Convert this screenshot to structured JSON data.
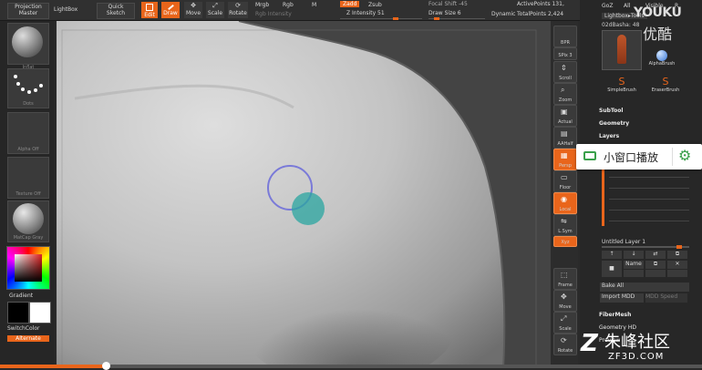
{
  "top_toolbar": {
    "projection_master": [
      "Projection",
      "Master"
    ],
    "lightbox": "LightBox",
    "quick_sketch": [
      "Quick",
      "Sketch"
    ],
    "edit": "Edit",
    "draw": "Draw",
    "move": "Move",
    "scale": "Scale",
    "rotate": "Rotate",
    "mrgb": "Mrgb",
    "rgb": "Rgb",
    "m": "M",
    "zadd": "Zadd",
    "zsub": "Zsub",
    "rgb_intensity": "Rgb Intensity",
    "z_intensity": "Z Intensity 51",
    "focal_shift": "Focal Shift -45",
    "draw_size": "Draw Size 6",
    "dynamic": "Dynamic",
    "active_points": "ActivePoints 131,",
    "total_points": "TotalPoints 2,424"
  },
  "left_panel": {
    "brush_label": "Inflat",
    "stroke_label": "Dots",
    "alpha_label": "Alpha Off",
    "texture_label": "Texture Off",
    "material_label": "MatCap Gray",
    "gradient_label": "Gradient",
    "switch_color_label": "SwitchColor",
    "alternate_label": "Alternate"
  },
  "view_controls": [
    {
      "name": "bpr",
      "label": "BPR"
    },
    {
      "name": "spix",
      "label": "SPix 3"
    },
    {
      "name": "scroll",
      "label": "Scroll"
    },
    {
      "name": "zoom",
      "label": "Zoom"
    },
    {
      "name": "actual",
      "label": "Actual"
    },
    {
      "name": "aahalf",
      "label": "AAHalf"
    },
    {
      "name": "persp",
      "label": "Persp"
    },
    {
      "name": "floor",
      "label": "Floor"
    },
    {
      "name": "local",
      "label": "Local"
    },
    {
      "name": "lsym",
      "label": "L.Sym"
    },
    {
      "name": "xyz",
      "label": "Xyz"
    },
    {
      "name": "frame",
      "label": "Frame"
    },
    {
      "name": "move",
      "label": "Move"
    },
    {
      "name": "scale",
      "label": "Scale"
    },
    {
      "name": "rotate",
      "label": "Rotate"
    }
  ],
  "right_panel": {
    "goz": "GoZ",
    "all": "All",
    "visible": "Visible",
    "r": "R",
    "lightbox_tools": "Lightbox▸Tools",
    "tool_name": "02dBasha: 48",
    "brushes": [
      {
        "name": "AlphaBrush"
      },
      {
        "name": "SimpleBrush"
      },
      {
        "name": "EraserBrush"
      }
    ],
    "subtool": "SubTool",
    "geometry": "Geometry",
    "layers": "Layers",
    "layer_name": "Untitled Layer 1",
    "name_btn": "Name",
    "bake_all": "Bake All",
    "import_mdd": "Import MDD",
    "mdd_speed": "MDD Speed",
    "fibermesh": "FiberMesh",
    "geometry_hd": "Geometry HD",
    "preview": "Preview"
  },
  "overlay": {
    "popup_label": "小窗口播放",
    "watermark_youku": "YOUKU",
    "watermark_youku_cn": "优酷",
    "watermark_site": "朱峰社区",
    "watermark_url": "ZF3D.COM"
  },
  "video_progress": 0.15,
  "colors": {
    "accent": "#e9651b",
    "popup_green": "#3aa04a",
    "cursor_ring": "#7a7ad8",
    "cursor_fill": "#2aa6a0"
  }
}
